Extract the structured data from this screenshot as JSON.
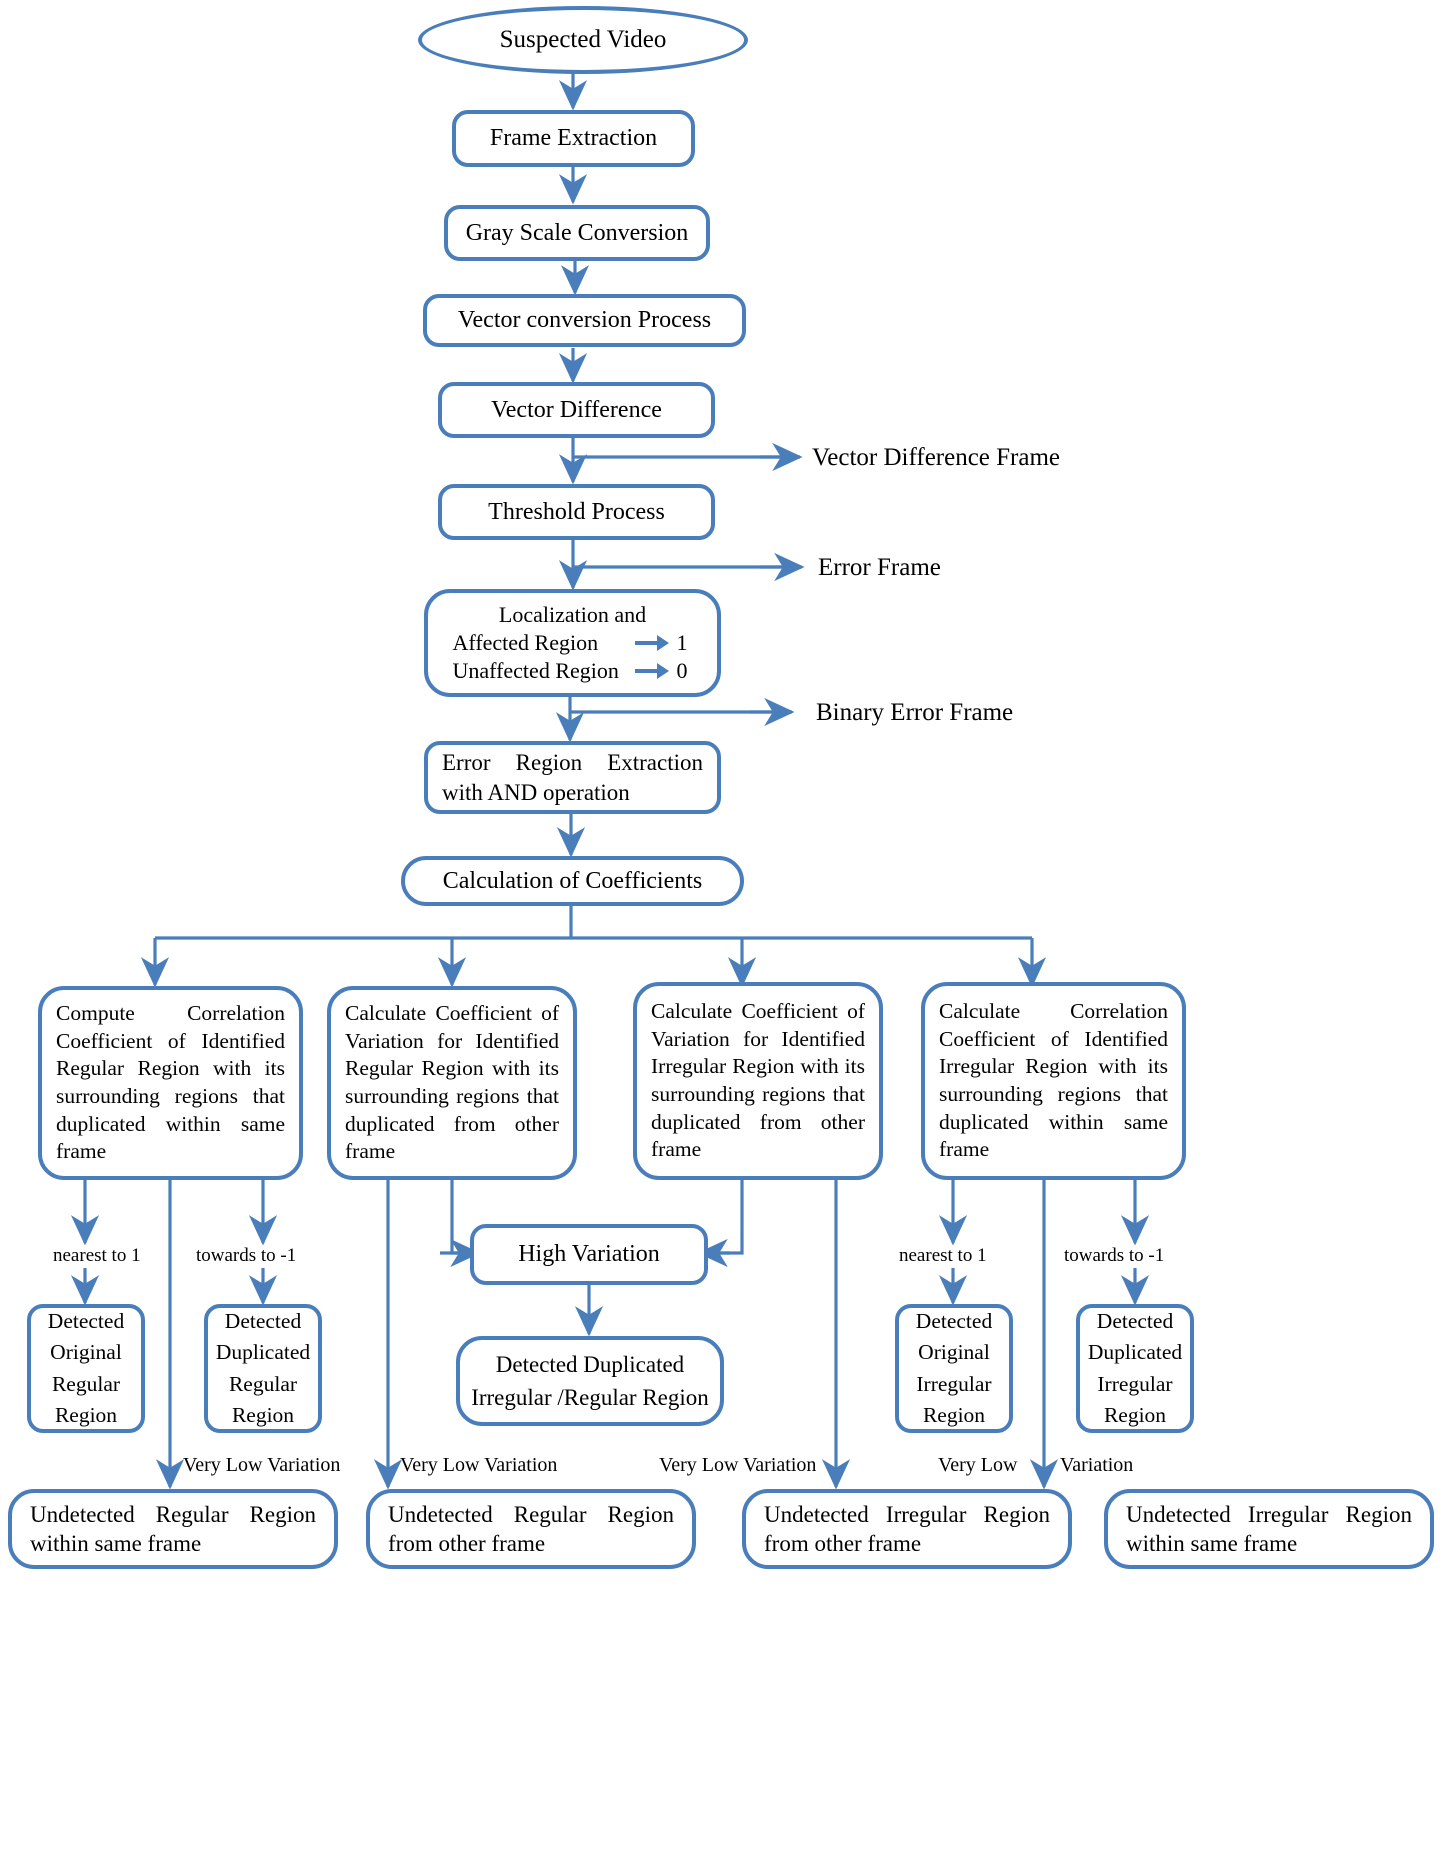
{
  "diagram": {
    "title": "Video Forgery Detection Flowchart",
    "accent_color": "#4a7ebb",
    "text_color": "#000000",
    "background": "#ffffff"
  },
  "nodes": {
    "start": {
      "label": "Suspected Video"
    },
    "frame_extraction": {
      "label": "Frame Extraction"
    },
    "gray_scale": {
      "label": "Gray Scale Conversion"
    },
    "vector_conversion": {
      "label": "Vector conversion Process"
    },
    "vector_difference": {
      "label": "Vector Difference"
    },
    "threshold": {
      "label": "Threshold Process"
    },
    "localization": {
      "title": "Localization and",
      "rows": [
        {
          "name": "Affected Region",
          "value": "1"
        },
        {
          "name": "Unaffected Region",
          "value": "0"
        }
      ]
    },
    "error_region": {
      "label": "Error Region Extraction with AND operation"
    },
    "calc_coefficients": {
      "label": "Calculation of Coefficients"
    },
    "branch1": {
      "label": "Compute Correlation Coefficient of Identified Regular Region with its surrounding regions that duplicated within same frame"
    },
    "branch2": {
      "label": "Calculate Coefficient of Variation for Identified Regular Region with its surrounding regions that duplicated from other frame"
    },
    "branch3": {
      "label": "Calculate Coefficient of Variation for Identified Irregular Region with its surrounding regions that duplicated from other frame"
    },
    "branch4": {
      "label": "Calculate Correlation Coefficient of Identified Irregular Region with its surrounding regions that duplicated within same frame"
    },
    "high_variation": {
      "label": "High Variation"
    },
    "detected_original_regular": {
      "label": "Detected Original Regular Region"
    },
    "detected_duplicated_regular": {
      "label": "Detected Duplicated Regular Region"
    },
    "detected_duplicated_irregular_regular": {
      "label": "Detected Duplicated Irregular /Regular Region"
    },
    "detected_original_irregular": {
      "label": "Detected Original Irregular Region"
    },
    "detected_duplicated_irregular": {
      "label": "Detected Duplicated Irregular Region"
    },
    "undetected_regular_same": {
      "label": "Undetected Regular Region within same frame"
    },
    "undetected_regular_other": {
      "label": "Undetected Regular Region from other frame"
    },
    "undetected_irregular_other": {
      "label": "Undetected Irregular Region from other frame"
    },
    "undetected_irregular_same": {
      "label": "Undetected Irregular Region within same frame"
    }
  },
  "side_outputs": [
    {
      "label": "Vector Difference Frame"
    },
    {
      "label": "Error Frame"
    },
    {
      "label": "Binary Error Frame"
    }
  ],
  "edge_labels": {
    "nearest_left": "nearest to 1",
    "towards_left": "towards to -1",
    "nearest_right": "nearest to 1",
    "towards_right": "towards to -1",
    "very_low_1": "Very Low Variation",
    "very_low_2": "Very Low Variation",
    "very_low_3": "Very Low Variation",
    "very_low_4a": "Very Low",
    "very_low_4b": "Variation"
  }
}
